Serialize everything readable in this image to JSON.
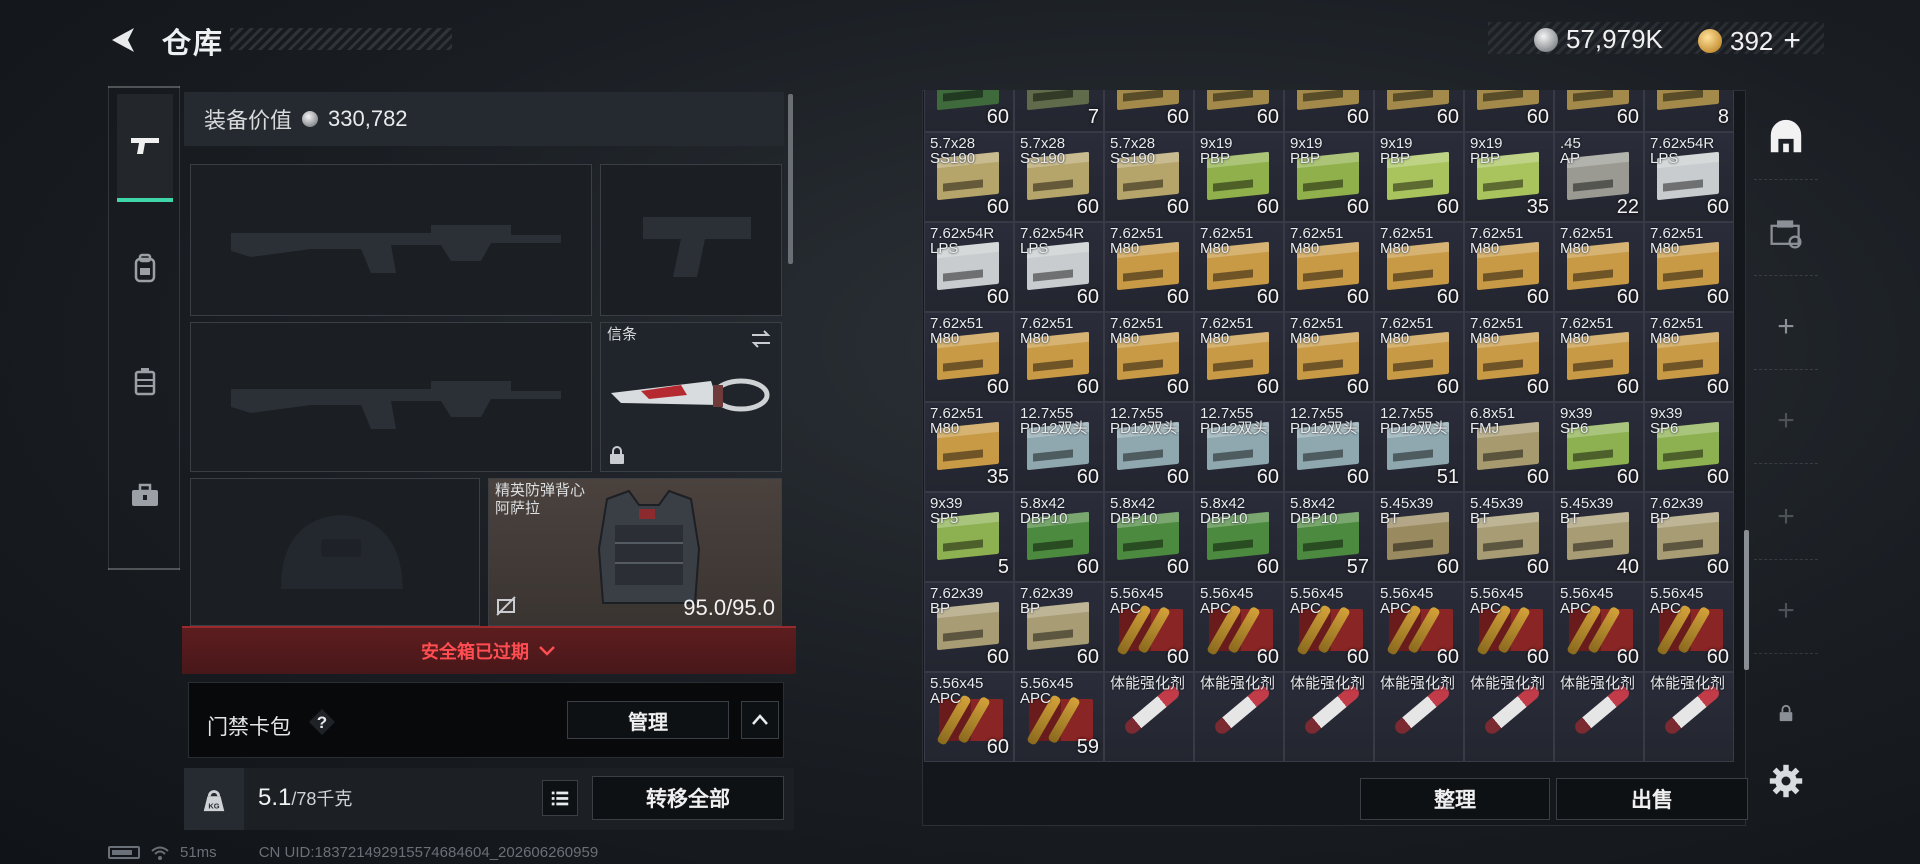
{
  "header": {
    "title": "仓库",
    "silver_amount": "57,979K",
    "gold_amount": "392",
    "add_symbol": "+"
  },
  "nav": {
    "items": [
      {
        "icon": "pistol-icon",
        "active": true
      },
      {
        "icon": "backpack-icon",
        "active": false
      },
      {
        "icon": "vest-rig-icon",
        "active": false
      },
      {
        "icon": "toolbox-icon",
        "active": false
      }
    ]
  },
  "loadout": {
    "equip_value_label": "装备价值",
    "equip_value": "330,782",
    "melee_label": "信条",
    "vest_name_line1": "精英防弹背心",
    "vest_name_line2": "阿萨拉",
    "vest_durability": "95.0/95.0",
    "safe_box_status": "安全箱已过期",
    "keycard_label": "门禁卡包",
    "help_symbol": "?",
    "manage_label": "管理",
    "weight_current": "5.1",
    "weight_capacity": "/78千克",
    "transfer_all_label": "转移全部"
  },
  "status": {
    "ping": "51ms",
    "uid": "CN UID:183721492915574684604_202606260959"
  },
  "warehouse": {
    "sort_label": "整理",
    "sell_label": "出售",
    "items": [
      {
        "name": "",
        "qty": "60",
        "kind": "ammo",
        "color": "#3f6b3c"
      },
      {
        "name": "",
        "qty": "7",
        "kind": "ammo",
        "color": "#5f6b4a"
      },
      {
        "name": "",
        "qty": "60",
        "kind": "ammo",
        "color": "#a38a4a"
      },
      {
        "name": "",
        "qty": "60",
        "kind": "ammo",
        "color": "#a38a4a"
      },
      {
        "name": "",
        "qty": "60",
        "kind": "ammo",
        "color": "#a38a4a"
      },
      {
        "name": "",
        "qty": "60",
        "kind": "ammo",
        "color": "#a38a4a"
      },
      {
        "name": "",
        "qty": "60",
        "kind": "ammo",
        "color": "#a38a4a"
      },
      {
        "name": "",
        "qty": "60",
        "kind": "ammo",
        "color": "#a38a4a"
      },
      {
        "name": "",
        "qty": "8",
        "kind": "ammo",
        "color": "#a38a4a"
      },
      {
        "name": "5.7x28\nSS190",
        "qty": "60",
        "kind": "ammo",
        "color": "#b6a56b"
      },
      {
        "name": "5.7x28\nSS190",
        "qty": "60",
        "kind": "ammo",
        "color": "#b6a56b"
      },
      {
        "name": "5.7x28\nSS190",
        "qty": "60",
        "kind": "ammo",
        "color": "#b6a56b"
      },
      {
        "name": "9x19\nPBP",
        "qty": "60",
        "kind": "ammo",
        "color": "#8fb04a"
      },
      {
        "name": "9x19\nPBP",
        "qty": "60",
        "kind": "ammo",
        "color": "#8fb04a"
      },
      {
        "name": "9x19\nPBP",
        "qty": "60",
        "kind": "ammo",
        "color": "#a9c45c"
      },
      {
        "name": "9x19\nPBP",
        "qty": "35",
        "kind": "ammo",
        "color": "#a9c45c"
      },
      {
        "name": ".45\nAP",
        "qty": "22",
        "kind": "ammo",
        "color": "#9a9a92"
      },
      {
        "name": "7.62x54R\nLPS",
        "qty": "60",
        "kind": "ammo",
        "color": "#c9ccce"
      },
      {
        "name": "7.62x54R\nLPS",
        "qty": "60",
        "kind": "ammo",
        "color": "#c9ccce"
      },
      {
        "name": "7.62x54R\nLPS",
        "qty": "60",
        "kind": "ammo",
        "color": "#c9ccce"
      },
      {
        "name": "7.62x51\nM80",
        "qty": "60",
        "kind": "ammo",
        "color": "#c89a45"
      },
      {
        "name": "7.62x51\nM80",
        "qty": "60",
        "kind": "ammo",
        "color": "#c89a45"
      },
      {
        "name": "7.62x51\nM80",
        "qty": "60",
        "kind": "ammo",
        "color": "#c89a45"
      },
      {
        "name": "7.62x51\nM80",
        "qty": "60",
        "kind": "ammo",
        "color": "#c89a45"
      },
      {
        "name": "7.62x51\nM80",
        "qty": "60",
        "kind": "ammo",
        "color": "#c89a45"
      },
      {
        "name": "7.62x51\nM80",
        "qty": "60",
        "kind": "ammo",
        "color": "#c89a45"
      },
      {
        "name": "7.62x51\nM80",
        "qty": "60",
        "kind": "ammo",
        "color": "#c89a45"
      },
      {
        "name": "7.62x51\nM80",
        "qty": "60",
        "kind": "ammo",
        "color": "#c89a45"
      },
      {
        "name": "7.62x51\nM80",
        "qty": "60",
        "kind": "ammo",
        "color": "#c89a45"
      },
      {
        "name": "7.62x51\nM80",
        "qty": "60",
        "kind": "ammo",
        "color": "#c89a45"
      },
      {
        "name": "7.62x51\nM80",
        "qty": "60",
        "kind": "ammo",
        "color": "#c89a45"
      },
      {
        "name": "7.62x51\nM80",
        "qty": "60",
        "kind": "ammo",
        "color": "#c89a45"
      },
      {
        "name": "7.62x51\nM80",
        "qty": "60",
        "kind": "ammo",
        "color": "#c89a45"
      },
      {
        "name": "7.62x51\nM80",
        "qty": "60",
        "kind": "ammo",
        "color": "#c89a45"
      },
      {
        "name": "7.62x51\nM80",
        "qty": "60",
        "kind": "ammo",
        "color": "#c89a45"
      },
      {
        "name": "7.62x51\nM80",
        "qty": "60",
        "kind": "ammo",
        "color": "#c89a45"
      },
      {
        "name": "7.62x51\nM80",
        "qty": "35",
        "kind": "ammo",
        "color": "#c89a45"
      },
      {
        "name": "12.7x55\nPD12双头",
        "qty": "60",
        "kind": "ammo",
        "color": "#8fa8b0"
      },
      {
        "name": "12.7x55\nPD12双头",
        "qty": "60",
        "kind": "ammo",
        "color": "#8fa8b0"
      },
      {
        "name": "12.7x55\nPD12双头",
        "qty": "60",
        "kind": "ammo",
        "color": "#8fa8b0"
      },
      {
        "name": "12.7x55\nPD12双头",
        "qty": "60",
        "kind": "ammo",
        "color": "#8fa8b0"
      },
      {
        "name": "12.7x55\nPD12双头",
        "qty": "51",
        "kind": "ammo",
        "color": "#8fa8b0"
      },
      {
        "name": "6.8x51\nFMJ",
        "qty": "60",
        "kind": "ammo",
        "color": "#a79a6e"
      },
      {
        "name": "9x39\nSP6",
        "qty": "60",
        "kind": "ammo",
        "color": "#8db050"
      },
      {
        "name": "9x39\nSP6",
        "qty": "60",
        "kind": "ammo",
        "color": "#8db050"
      },
      {
        "name": "9x39\nSP5",
        "qty": "5",
        "kind": "ammo",
        "color": "#8db050"
      },
      {
        "name": "5.8x42\nDBP10",
        "qty": "60",
        "kind": "ammo",
        "color": "#4c8a3f"
      },
      {
        "name": "5.8x42\nDBP10",
        "qty": "60",
        "kind": "ammo",
        "color": "#4c8a3f"
      },
      {
        "name": "5.8x42\nDBP10",
        "qty": "60",
        "kind": "ammo",
        "color": "#4c8a3f"
      },
      {
        "name": "5.8x42\nDBP10",
        "qty": "57",
        "kind": "ammo",
        "color": "#4c8a3f"
      },
      {
        "name": "5.45x39\nBT",
        "qty": "60",
        "kind": "ammo",
        "color": "#9a8a60"
      },
      {
        "name": "5.45x39\nBT",
        "qty": "60",
        "kind": "ammo",
        "color": "#a89c74"
      },
      {
        "name": "5.45x39\nBT",
        "qty": "40",
        "kind": "ammo",
        "color": "#a89c74"
      },
      {
        "name": "7.62x39\nBP",
        "qty": "60",
        "kind": "ammo",
        "color": "#a89c74"
      },
      {
        "name": "7.62x39\nBP",
        "qty": "60",
        "kind": "ammo",
        "color": "#a89c74"
      },
      {
        "name": "7.62x39\nBP",
        "qty": "60",
        "kind": "ammo",
        "color": "#a89c74"
      },
      {
        "name": "5.56x45\nAPC",
        "qty": "60",
        "kind": "rounds",
        "color": "#7a2020"
      },
      {
        "name": "5.56x45\nAPC",
        "qty": "60",
        "kind": "rounds",
        "color": "#7a2020"
      },
      {
        "name": "5.56x45\nAPC",
        "qty": "60",
        "kind": "rounds",
        "color": "#7a2020"
      },
      {
        "name": "5.56x45\nAPC",
        "qty": "60",
        "kind": "rounds",
        "color": "#7a2020"
      },
      {
        "name": "5.56x45\nAPC",
        "qty": "60",
        "kind": "rounds",
        "color": "#7a2020"
      },
      {
        "name": "5.56x45\nAPC",
        "qty": "60",
        "kind": "rounds",
        "color": "#7a2020"
      },
      {
        "name": "5.56x45\nAPC",
        "qty": "60",
        "kind": "rounds",
        "color": "#7a2020"
      },
      {
        "name": "5.56x45\nAPC",
        "qty": "60",
        "kind": "rounds",
        "color": "#7a2020"
      },
      {
        "name": "5.56x45\nAPC",
        "qty": "59",
        "kind": "rounds",
        "color": "#7a2020"
      },
      {
        "name": "体能强化剂",
        "qty": "",
        "kind": "stim",
        "color": "#c23b48"
      },
      {
        "name": "体能强化剂",
        "qty": "",
        "kind": "stim",
        "color": "#c23b48"
      },
      {
        "name": "体能强化剂",
        "qty": "",
        "kind": "stim",
        "color": "#c23b48"
      },
      {
        "name": "体能强化剂",
        "qty": "",
        "kind": "stim",
        "color": "#c23b48"
      },
      {
        "name": "体能强化剂",
        "qty": "",
        "kind": "stim",
        "color": "#c23b48"
      },
      {
        "name": "体能强化剂",
        "qty": "",
        "kind": "stim",
        "color": "#c23b48"
      },
      {
        "name": "体能强化剂",
        "qty": "",
        "kind": "stim",
        "color": "#c23b48"
      }
    ]
  },
  "rail": {
    "items": [
      {
        "icon": "safehouse-icon"
      },
      {
        "icon": "cash-register-icon"
      },
      {
        "icon": "add-slot-icon"
      },
      {
        "icon": "add-slot-icon"
      },
      {
        "icon": "add-slot-icon"
      },
      {
        "icon": "add-slot-icon"
      },
      {
        "icon": "lock-icon"
      },
      {
        "icon": "settings-gear-icon"
      }
    ]
  },
  "colors": {
    "accent_green": "#3fd6a9",
    "warning_red": "#ff4d52"
  }
}
